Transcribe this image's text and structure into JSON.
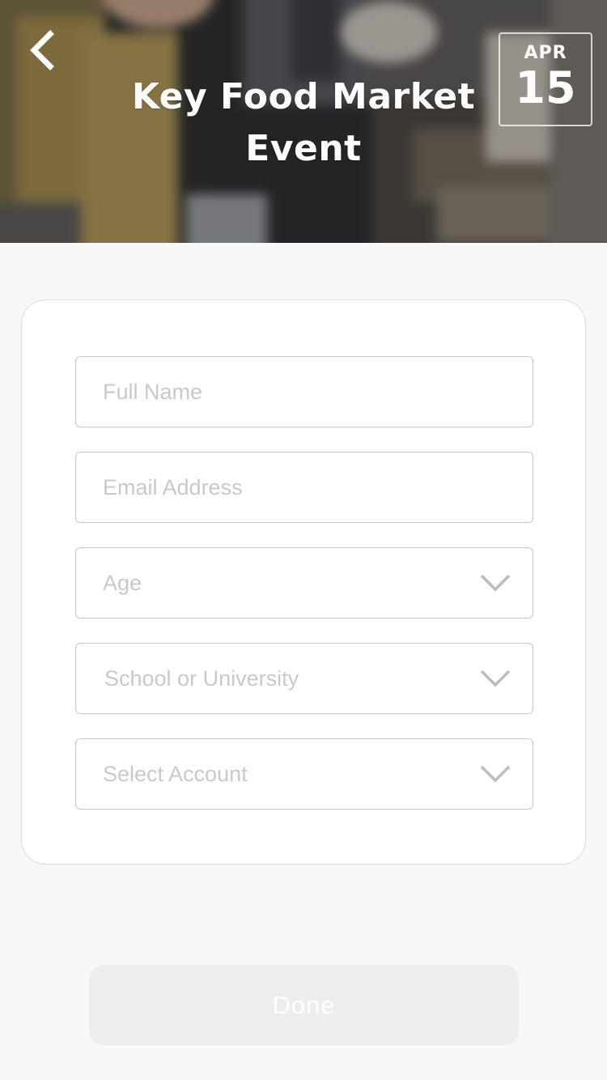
{
  "header": {
    "title_line1": "Key Food Market",
    "title_line2": "Event",
    "back_icon": "chevron-left-icon",
    "date": {
      "month": "APR",
      "day": "15"
    }
  },
  "form": {
    "full_name": {
      "placeholder": "Full Name",
      "value": ""
    },
    "email": {
      "placeholder": "Email Address",
      "value": ""
    },
    "age": {
      "label": "Age",
      "icon": "chevron-down-icon"
    },
    "school": {
      "label": "School or University",
      "icon": "chevron-down-icon"
    },
    "account": {
      "label": "Select Account",
      "icon": "chevron-down-icon"
    }
  },
  "done_label": "Done",
  "colors": {
    "page_bg": "#f8f8f8",
    "field_border": "#c8c8c8",
    "placeholder": "#c9c9c9",
    "button_bg": "#ededed",
    "button_text": "#ffffff"
  }
}
